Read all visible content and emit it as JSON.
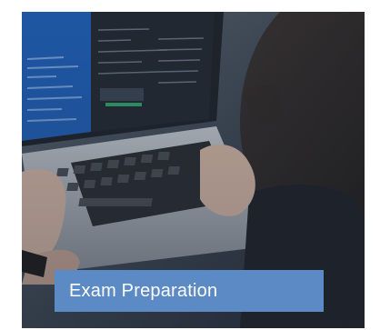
{
  "card": {
    "caption": "Exam Preparation",
    "image_subject": "person typing on laptop keyboard with code on screen"
  },
  "colors": {
    "caption_bg": "#5b8ac4",
    "caption_text": "#ffffff",
    "screen_blue": "#1f6fd1",
    "laptop_silver": "#b7bdc6"
  }
}
